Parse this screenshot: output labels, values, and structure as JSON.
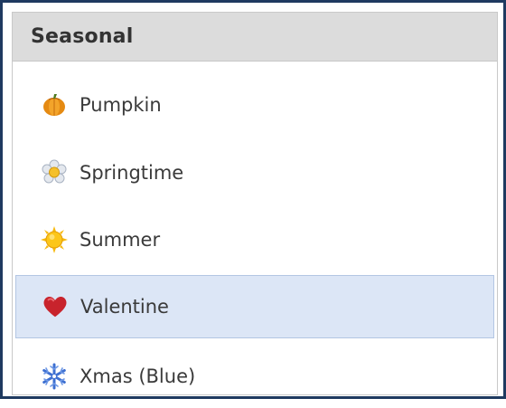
{
  "panel": {
    "title": "Seasonal"
  },
  "items": [
    {
      "label": "Pumpkin",
      "icon": "pumpkin-icon"
    },
    {
      "label": "Springtime",
      "icon": "flower-icon"
    },
    {
      "label": "Summer",
      "icon": "sun-icon"
    },
    {
      "label": "Valentine",
      "icon": "heart-icon",
      "selected": true
    },
    {
      "label": "Xmas (Blue)",
      "icon": "snowflake-icon"
    }
  ],
  "colors": {
    "frame_border": "#1f3a60",
    "header_background": "#dcdcdc",
    "selected_background": "#dce6f6",
    "selected_border": "#b3c6e3"
  }
}
